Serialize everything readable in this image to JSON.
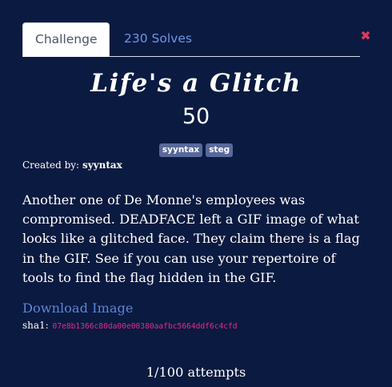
{
  "tabs": {
    "challenge": "Challenge",
    "solves": "230 Solves"
  },
  "close_symbol": "✖",
  "challenge": {
    "title": "Life's a Glitch",
    "points": "50",
    "tags": [
      "syyntax",
      "steg"
    ],
    "created_by_label": "Created by:",
    "author": "syyntax",
    "description": "Another one of De Monne's employees was compromised. DEADFACE left a GIF image of what looks like a glitched face. They claim there is a flag in the GIF. See if you can use your repertoire of tools to find the flag hidden in the GIF.",
    "download_label": "Download Image",
    "sha_label": "sha1:",
    "sha_value": "07e8b1366c80da00e00380aafbc5664ddf6c4cfd",
    "attempts": "1/100 attempts"
  },
  "colors": {
    "background": "#0b1a40",
    "link": "#5b85d7",
    "hash": "#e02d8c",
    "close": "#e0385c",
    "tag": "#58689a"
  }
}
